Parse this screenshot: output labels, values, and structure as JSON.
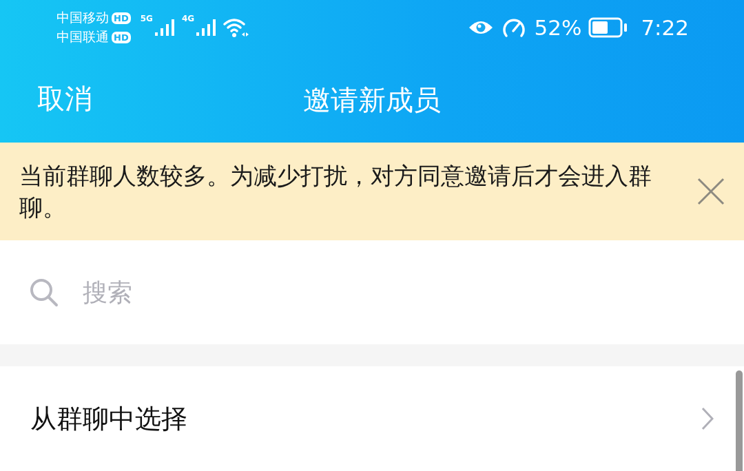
{
  "status_bar": {
    "carriers": [
      {
        "name": "中国移动",
        "badge": "HD"
      },
      {
        "name": "中国联通",
        "badge": "HD"
      }
    ],
    "signals": [
      {
        "label": "5G"
      },
      {
        "label": "4G"
      }
    ],
    "battery_text": "52%",
    "time": "7:22"
  },
  "header": {
    "cancel": "取消",
    "title": "邀请新成员"
  },
  "notice": {
    "text": "当前群聊人数较多。为减少打扰，对方同意邀请后才会进入群聊。"
  },
  "search": {
    "placeholder": "搜索"
  },
  "list": [
    {
      "label": "从群聊中选择"
    }
  ]
}
